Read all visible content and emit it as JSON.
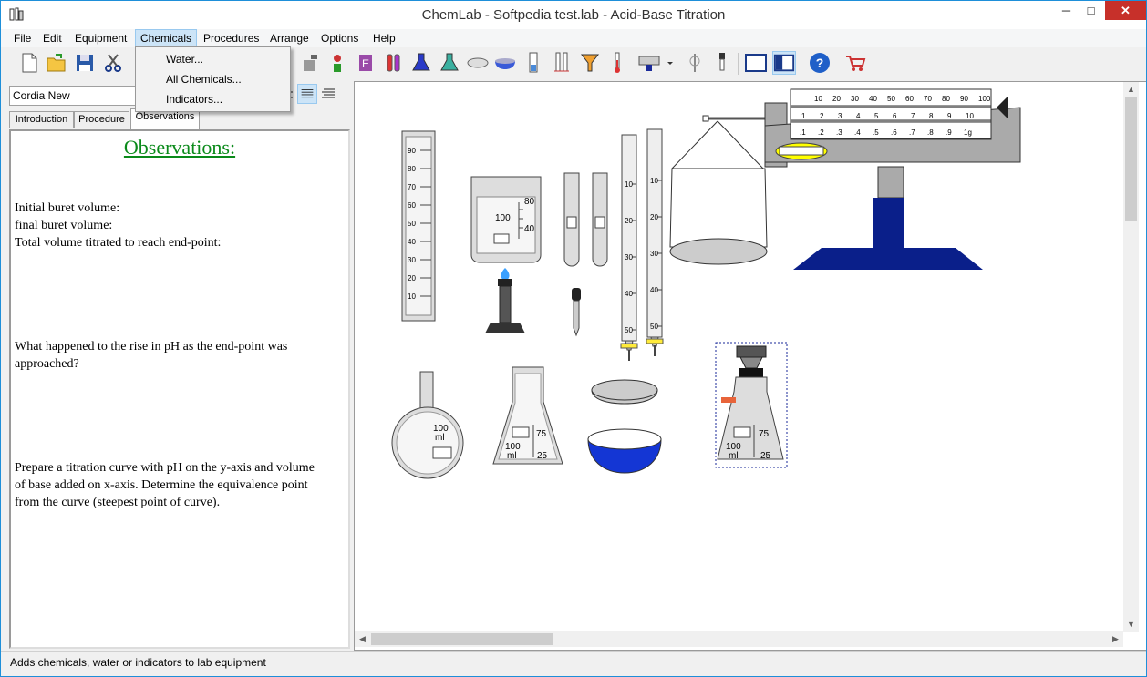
{
  "window": {
    "title": "ChemLab - Softpedia test.lab - Acid-Base Titration",
    "minimize_glyph": "─",
    "maximize_glyph": "□",
    "close_glyph": "✕"
  },
  "menu": {
    "items": [
      "File",
      "Edit",
      "Equipment",
      "Chemicals",
      "Procedures",
      "Arrange",
      "Options",
      "Help"
    ],
    "active": "Chemicals"
  },
  "dropdown": {
    "items": [
      "Water...",
      "All Chemicals...",
      "Indicators..."
    ]
  },
  "font_box": {
    "value": "Cordia New"
  },
  "tabs": {
    "items": [
      "Introduction",
      "Procedure",
      "Observations"
    ],
    "active": "Observations"
  },
  "notes": {
    "heading": "Observations:",
    "line1": "Initial buret volume:",
    "line2": "final buret volume:",
    "line3": "Total volume titrated to reach end-point:",
    "para2a": "What happened to the rise in pH as the end-point was",
    "para2b": "approached?",
    "para3a": "Prepare a titration curve with pH on the y-axis and volume",
    "para3b": "of base added on x-axis. Determine the equivalence point",
    "para3c": "from the curve (steepest point of curve)."
  },
  "status": {
    "text": "Adds chemicals, water or indicators to lab equipment"
  },
  "lab": {
    "cylinder_ticks": [
      "90",
      "80",
      "70",
      "60",
      "50",
      "40",
      "30",
      "20",
      "10"
    ],
    "beaker_labels": [
      "80",
      "100",
      "40"
    ],
    "buret_ticks": [
      "10",
      "20",
      "30",
      "40",
      "50"
    ],
    "balance_top": [
      "10",
      "20",
      "30",
      "40",
      "50",
      "60",
      "70",
      "80",
      "90",
      "100"
    ],
    "balance_mid": [
      "1",
      "2",
      "3",
      "4",
      "5",
      "6",
      "7",
      "8",
      "9",
      "10"
    ],
    "balance_low": [
      ".1",
      ".2",
      ".3",
      ".4",
      ".5",
      ".6",
      ".7",
      ".8",
      ".9",
      "1g"
    ],
    "flask_labels": {
      "vol": "100",
      "unit": "ml"
    },
    "erlen_labels": {
      "v75": "75",
      "v100": "100",
      "unit": "ml",
      "v25": "25"
    },
    "colors": {
      "blue": "#0a1f8a",
      "bowl": "#1436d4",
      "flame": "#3aa0ff",
      "yellow": "#ffff00"
    }
  }
}
